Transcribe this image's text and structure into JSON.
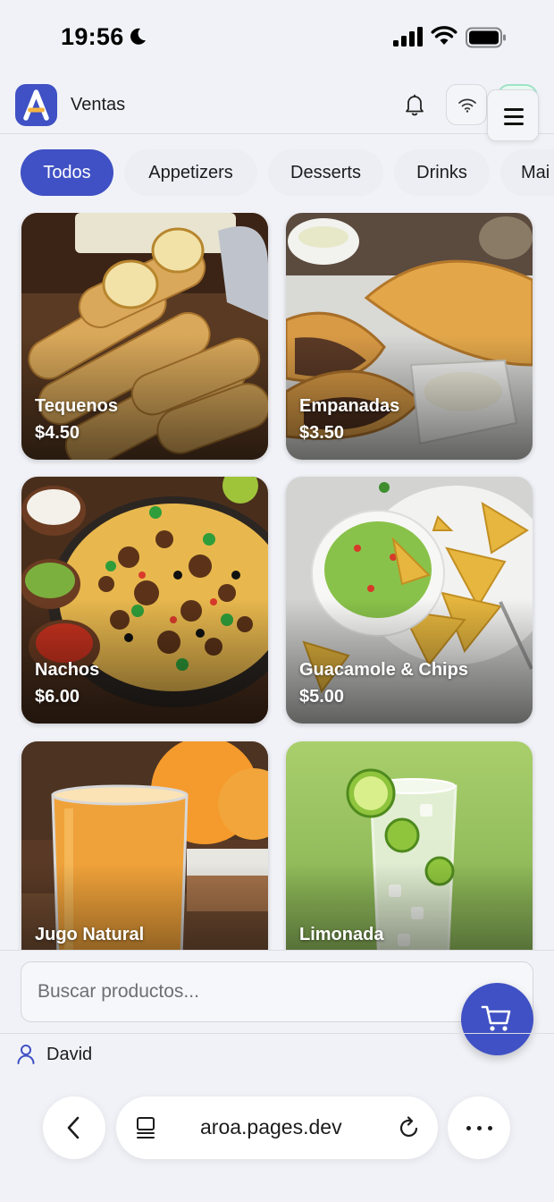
{
  "status_bar": {
    "time": "19:56"
  },
  "header": {
    "title": "Ventas"
  },
  "categories": [
    {
      "label": "Todos",
      "active": true
    },
    {
      "label": "Appetizers",
      "active": false
    },
    {
      "label": "Desserts",
      "active": false
    },
    {
      "label": "Drinks",
      "active": false
    },
    {
      "label": "Mai",
      "active": false
    }
  ],
  "products": [
    {
      "name": "Tequenos",
      "price": "$4.50"
    },
    {
      "name": "Empanadas",
      "price": "$3.50"
    },
    {
      "name": "Nachos",
      "price": "$6.00"
    },
    {
      "name": "Guacamole & Chips",
      "price": "$5.00"
    },
    {
      "name": "Jugo Natural",
      "price": ""
    },
    {
      "name": "Limonada",
      "price": ""
    }
  ],
  "search": {
    "placeholder": "Buscar productos..."
  },
  "user": {
    "name": "David"
  },
  "browser": {
    "url": "aroa.pages.dev"
  },
  "colors": {
    "accent": "#3f51c4",
    "background": "#f1f2f7"
  }
}
